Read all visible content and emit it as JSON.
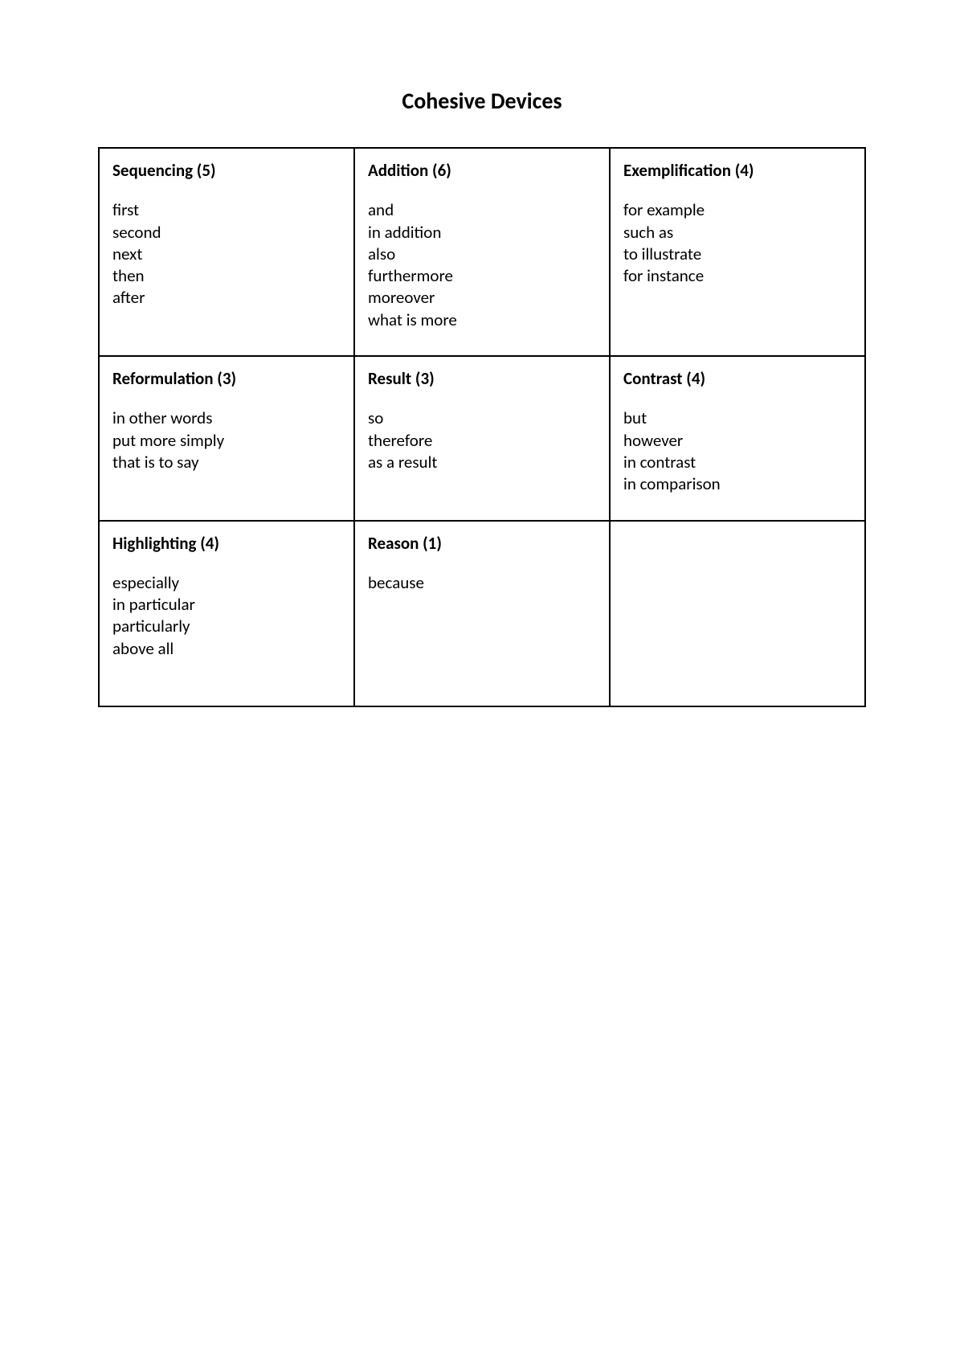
{
  "title": "Cohesive Devices",
  "cells": [
    [
      {
        "heading": "Sequencing (5)",
        "items": [
          "first",
          "second",
          "next",
          "then",
          "after"
        ]
      },
      {
        "heading": "Addition (6)",
        "items": [
          "and",
          "in addition",
          "also",
          "furthermore",
          "moreover",
          "what is more"
        ]
      },
      {
        "heading": "Exemplification (4)",
        "items": [
          "for example",
          "such as",
          "to illustrate",
          "for instance"
        ]
      }
    ],
    [
      {
        "heading": "Reformulation (3)",
        "items": [
          "in other words",
          "put more simply",
          "that is to say"
        ]
      },
      {
        "heading": "Result (3)",
        "items": [
          "so",
          "therefore",
          "as a result"
        ]
      },
      {
        "heading": "Contrast (4)",
        "items": [
          "but",
          "however",
          "in contrast",
          "in comparison"
        ]
      }
    ],
    [
      {
        "heading": "Highlighting (4)",
        "items": [
          "especially",
          "in particular",
          "particularly",
          "above all"
        ]
      },
      {
        "heading": "Reason (1)",
        "items": [
          "because"
        ]
      },
      {
        "heading": "",
        "items": []
      }
    ]
  ]
}
